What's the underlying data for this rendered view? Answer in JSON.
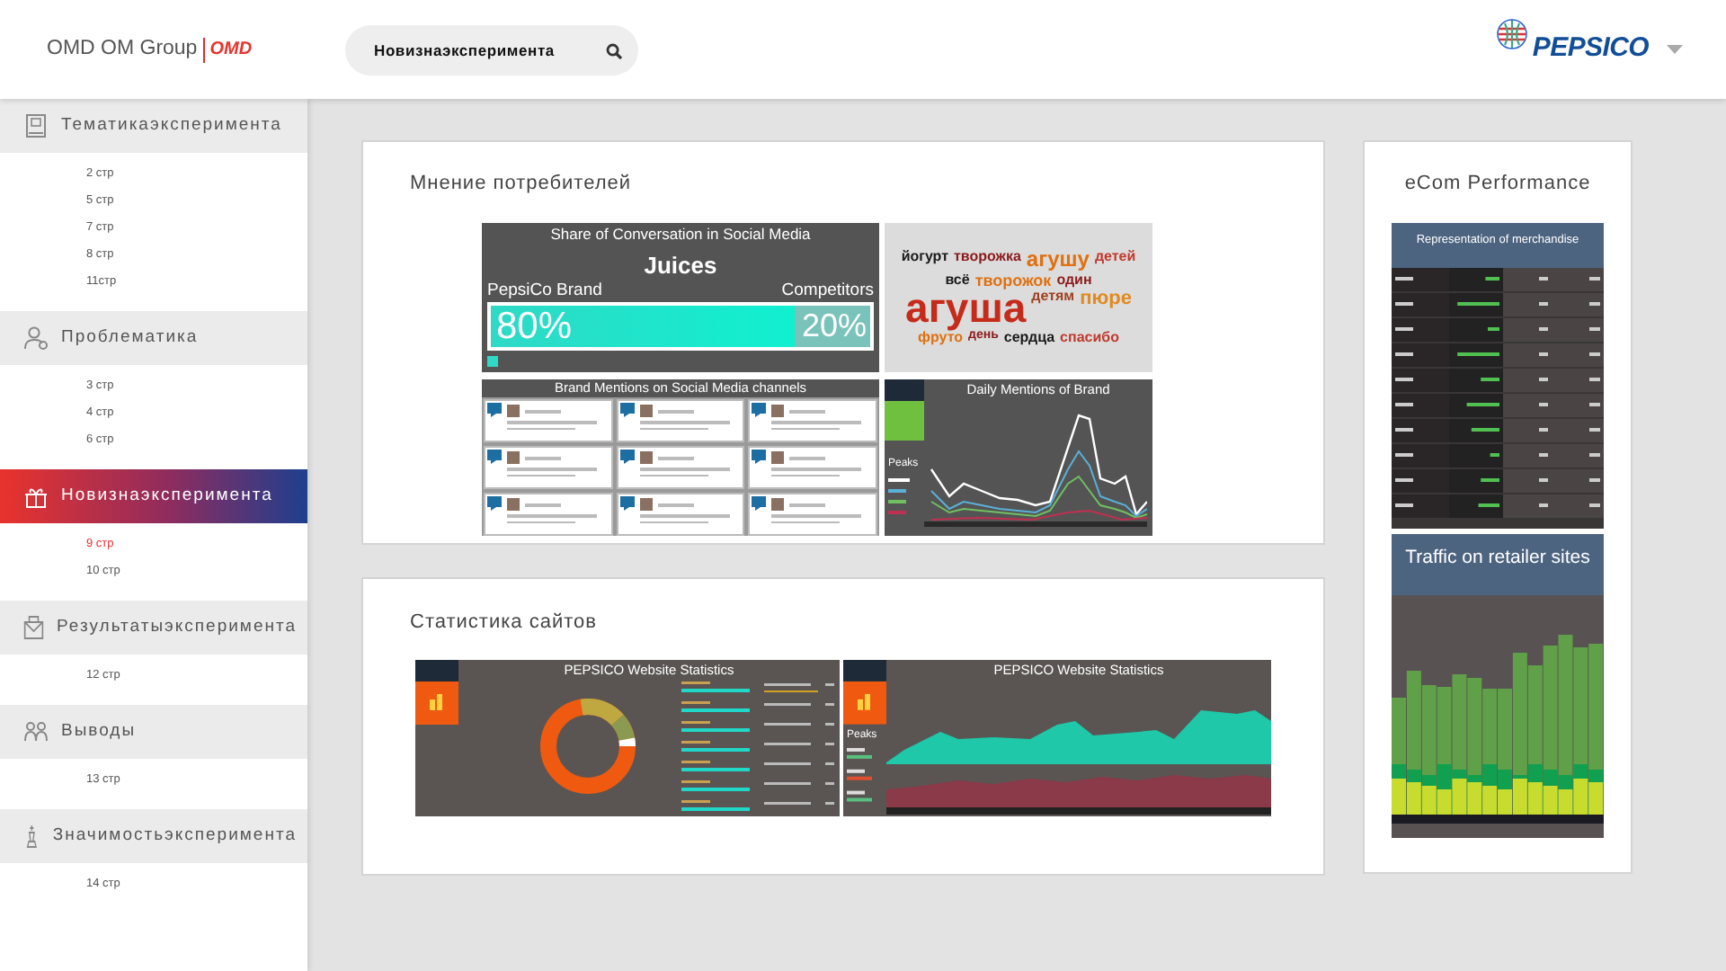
{
  "header": {
    "logo_text": "OMD OM Group",
    "logo_mark": "OMD",
    "search": {
      "value": "Новизнаэксперимента"
    },
    "brand": "PEPSICO"
  },
  "sidebar": {
    "sections": [
      {
        "title": "Тематикаэксперимента",
        "selected": false,
        "items": [
          {
            "label": "2 стр",
            "selected": false
          },
          {
            "label": "5 стр",
            "selected": false
          },
          {
            "label": "7 стр",
            "selected": false
          },
          {
            "label": "8 стр",
            "selected": false
          },
          {
            "label": "11стр",
            "selected": false
          }
        ]
      },
      {
        "title": "Проблематика",
        "selected": false,
        "items": [
          {
            "label": "3 стр",
            "selected": false
          },
          {
            "label": "4 стр",
            "selected": false
          },
          {
            "label": "6 стр",
            "selected": false
          }
        ]
      },
      {
        "title": "Новизнаэксперимента",
        "selected": true,
        "items": [
          {
            "label": "9 стр",
            "selected": true
          },
          {
            "label": "10 стр",
            "selected": false
          }
        ]
      },
      {
        "title": "Результатыэксперимента",
        "selected": false,
        "items": [
          {
            "label": "12 стр",
            "selected": false
          }
        ]
      },
      {
        "title": "Выводы",
        "selected": false,
        "items": [
          {
            "label": "13 стр",
            "selected": false
          }
        ]
      },
      {
        "title": "Значимостьэксперимента",
        "selected": false,
        "items": [
          {
            "label": "14 стр",
            "selected": false
          }
        ]
      }
    ]
  },
  "opinion_card": {
    "title": "Мнение потребителей",
    "share_tile": {
      "title": "Share of Conversation in Social Media",
      "category": "Juices",
      "left_label": "PepsiCo Brand",
      "right_label": "Competitors",
      "left_value": "80%",
      "right_value": "20%",
      "level": 0.8
    },
    "word_cloud": [
      {
        "text": "йогурт",
        "color": "#1a1a1a"
      },
      {
        "text": "творожка",
        "color": "#8b1a1a"
      },
      {
        "text": "агушу",
        "color": "#e07010"
      },
      {
        "text": "детей",
        "color": "#c0392b"
      },
      {
        "text": "всё",
        "color": "#1a1a1a"
      },
      {
        "text": "творожок",
        "color": "#e07010"
      },
      {
        "text": "один",
        "color": "#8b1a1a"
      },
      {
        "text": "агуша",
        "color": "#c62a1a"
      },
      {
        "text": "детям",
        "color": "#a04020"
      },
      {
        "text": "пюре",
        "color": "#e08a20"
      },
      {
        "text": "фруто",
        "color": "#e07010"
      },
      {
        "text": "день",
        "color": "#8b1a1a"
      },
      {
        "text": "сердца",
        "color": "#1a1a1a"
      },
      {
        "text": "спасибо",
        "color": "#c0392b"
      }
    ],
    "mentions_tile": {
      "title": "Brand Mentions on Social Media channels"
    },
    "daily_tile": {
      "title": "Daily Mentions of Brand",
      "legend_title": "Peaks"
    }
  },
  "stats_card": {
    "title": "Статистика сайтов",
    "dashboards": [
      {
        "title": "PEPSICO Website Statistics",
        "kind": "donut"
      },
      {
        "title": "PEPSICO Website Statistics",
        "kind": "area",
        "legend_title": "Peaks"
      }
    ]
  },
  "ecom_card": {
    "title": "eCom Performance",
    "merch_table": {
      "title": "Representation of merchandise"
    },
    "traffic_chart": {
      "title": "Traffic on retailer sites"
    }
  }
}
